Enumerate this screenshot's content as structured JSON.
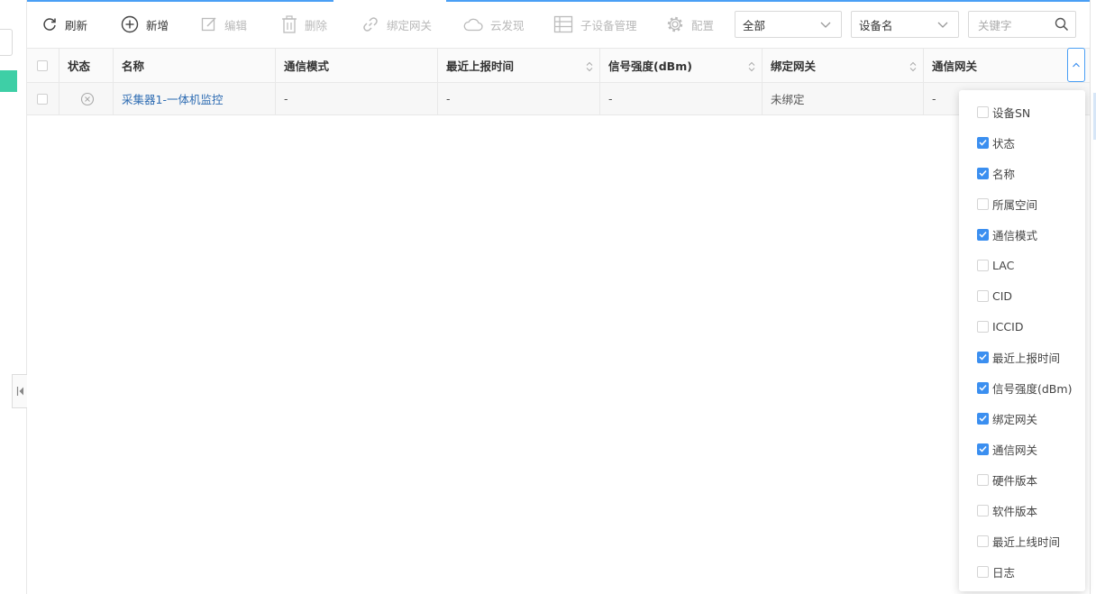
{
  "toolbar": {
    "refresh": "刷新",
    "add": "新增",
    "edit": "编辑",
    "delete": "删除",
    "bind_gateway": "绑定网关",
    "cloud_discover": "云发现",
    "sub_device_manage": "子设备管理",
    "config": "配置"
  },
  "filters": {
    "scope_select": "全部",
    "field_select": "设备名",
    "keyword_placeholder": "关键字"
  },
  "table": {
    "headers": {
      "status": "状态",
      "name": "名称",
      "comm_mode": "通信模式",
      "last_report_time": "最近上报时间",
      "signal_strength": "信号强度(dBm)",
      "bound_gateway": "绑定网关",
      "comm_gateway": "通信网关"
    },
    "rows": [
      {
        "name": "采集器1-一体机监控",
        "comm_mode": "-",
        "last_report_time": "-",
        "signal_strength": "-",
        "bound_gateway": "未绑定",
        "comm_gateway": "-"
      }
    ]
  },
  "column_menu": {
    "items": [
      {
        "label": "设备SN",
        "checked": false
      },
      {
        "label": "状态",
        "checked": true
      },
      {
        "label": "名称",
        "checked": true
      },
      {
        "label": "所属空间",
        "checked": false
      },
      {
        "label": "通信模式",
        "checked": true
      },
      {
        "label": "LAC",
        "checked": false
      },
      {
        "label": "CID",
        "checked": false
      },
      {
        "label": "ICCID",
        "checked": false
      },
      {
        "label": "最近上报时间",
        "checked": true
      },
      {
        "label": "信号强度(dBm)",
        "checked": true
      },
      {
        "label": "绑定网关",
        "checked": true
      },
      {
        "label": "通信网关",
        "checked": true
      },
      {
        "label": "硬件版本",
        "checked": false
      },
      {
        "label": "软件版本",
        "checked": false
      },
      {
        "label": "最近上线时间",
        "checked": false
      },
      {
        "label": "日志",
        "checked": false
      }
    ]
  },
  "colors": {
    "accent": "#4a9ff5",
    "checkbox_on": "#3b8ff0",
    "link": "#2f6db3",
    "sidebar_active": "#3ecfa6"
  }
}
